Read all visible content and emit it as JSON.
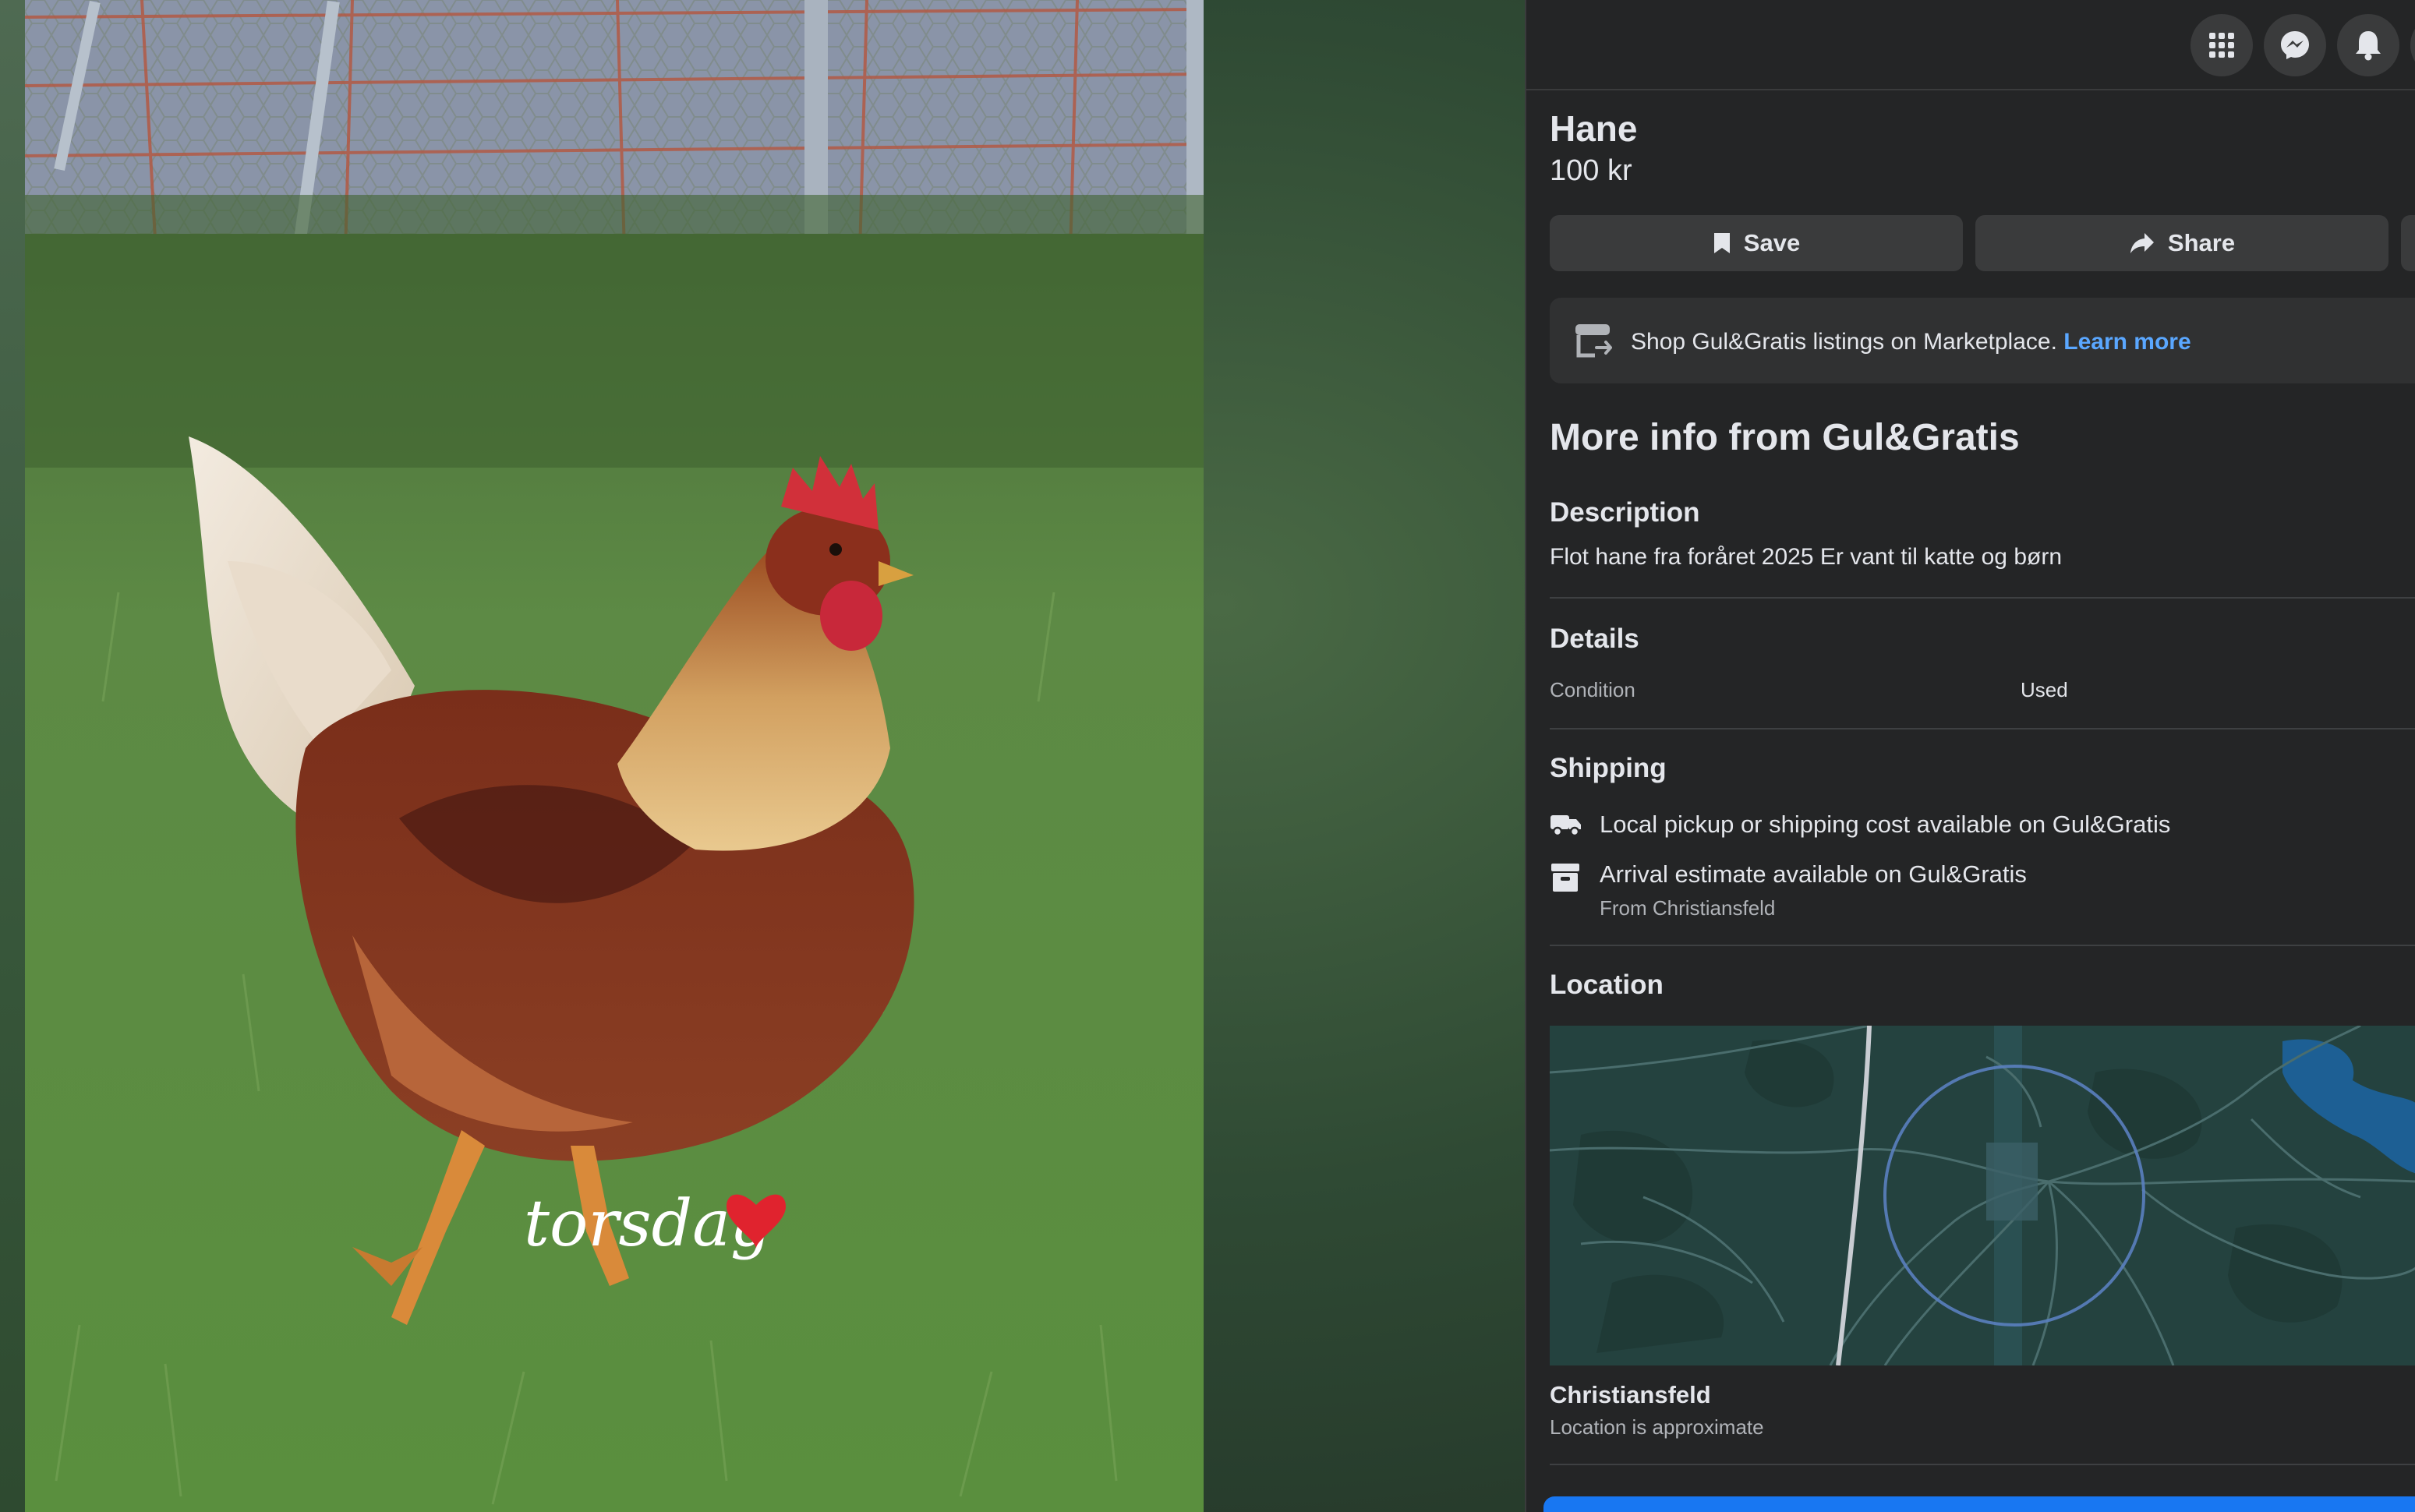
{
  "listing": {
    "title": "Hane",
    "price": "100 kr",
    "photo_overlay_text": "torsdag"
  },
  "actions": {
    "save_label": "Save",
    "share_label": "Share"
  },
  "topbar": {
    "icons": [
      "apps-grid-icon",
      "messenger-icon",
      "notifications-bell-icon"
    ]
  },
  "promo": {
    "text": "Shop Gul&Gratis listings on Marketplace.",
    "link": "Learn more"
  },
  "more_info": {
    "heading": "More info from Gul&Gratis"
  },
  "description": {
    "heading": "Description",
    "text": "Flot hane fra foråret 2025 Er vant til katte og børn"
  },
  "details": {
    "heading": "Details",
    "rows": [
      {
        "label": "Condition",
        "value": "Used"
      }
    ]
  },
  "shipping": {
    "heading": "Shipping",
    "items": [
      {
        "icon": "truck-icon",
        "text": "Local pickup or shipping cost available on Gul&Gratis",
        "subtext": ""
      },
      {
        "icon": "box-icon",
        "text": "Arrival estimate available on Gul&Gratis",
        "subtext": "From Christiansfeld"
      }
    ]
  },
  "location": {
    "heading": "Location",
    "city": "Christiansfeld",
    "note": "Location is approximate"
  },
  "colors": {
    "panel_bg": "#242526",
    "button_bg": "#3a3b3c",
    "link": "#5aa7ff",
    "primary": "#1877f2"
  }
}
